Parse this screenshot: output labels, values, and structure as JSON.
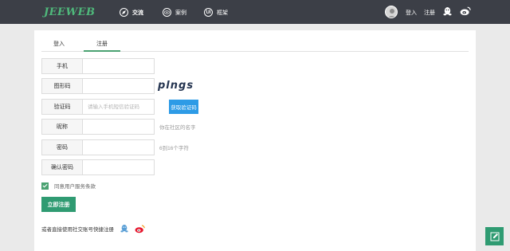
{
  "brand": {
    "logo_text": "JEEWEB"
  },
  "nav": {
    "items": [
      {
        "label": "交流",
        "icon": "compass-icon",
        "active": true
      },
      {
        "label": "案例",
        "icon": "eye-icon",
        "active": false
      },
      {
        "label": "框架",
        "icon": "ui-icon",
        "icon_text": "UI",
        "active": false
      }
    ],
    "login_label": "登入",
    "register_label": "注册"
  },
  "tabs": [
    {
      "label": "登入",
      "active": false
    },
    {
      "label": "注册",
      "active": true
    }
  ],
  "form": {
    "phone": {
      "label": "手机",
      "value": "",
      "placeholder": ""
    },
    "captcha": {
      "label": "图形码",
      "value": "",
      "placeholder": "",
      "image_text": "plngs"
    },
    "verify_code": {
      "label": "验证码",
      "value": "",
      "placeholder": "请输入手机短信验证码",
      "button_label": "获取验证码"
    },
    "nickname": {
      "label": "昵称",
      "value": "",
      "placeholder": "",
      "hint": "你在社区的名字"
    },
    "password": {
      "label": "密码",
      "value": "",
      "placeholder": "",
      "hint": "6到16个字符"
    },
    "confirm_password": {
      "label": "确认密码",
      "value": "",
      "placeholder": ""
    },
    "agree": {
      "label": "同意用户服务条款",
      "checked": true
    },
    "submit_label": "立即注册",
    "social_prompt": "或者直接使用社交账号快捷注册"
  },
  "colors": {
    "topbar": "#3c3f47",
    "logo": "#4fb87b",
    "accent_green": "#2f9b72",
    "accent_blue": "#2d9be6",
    "weibo": "#e6162d",
    "qq": "#5a9fd6"
  }
}
